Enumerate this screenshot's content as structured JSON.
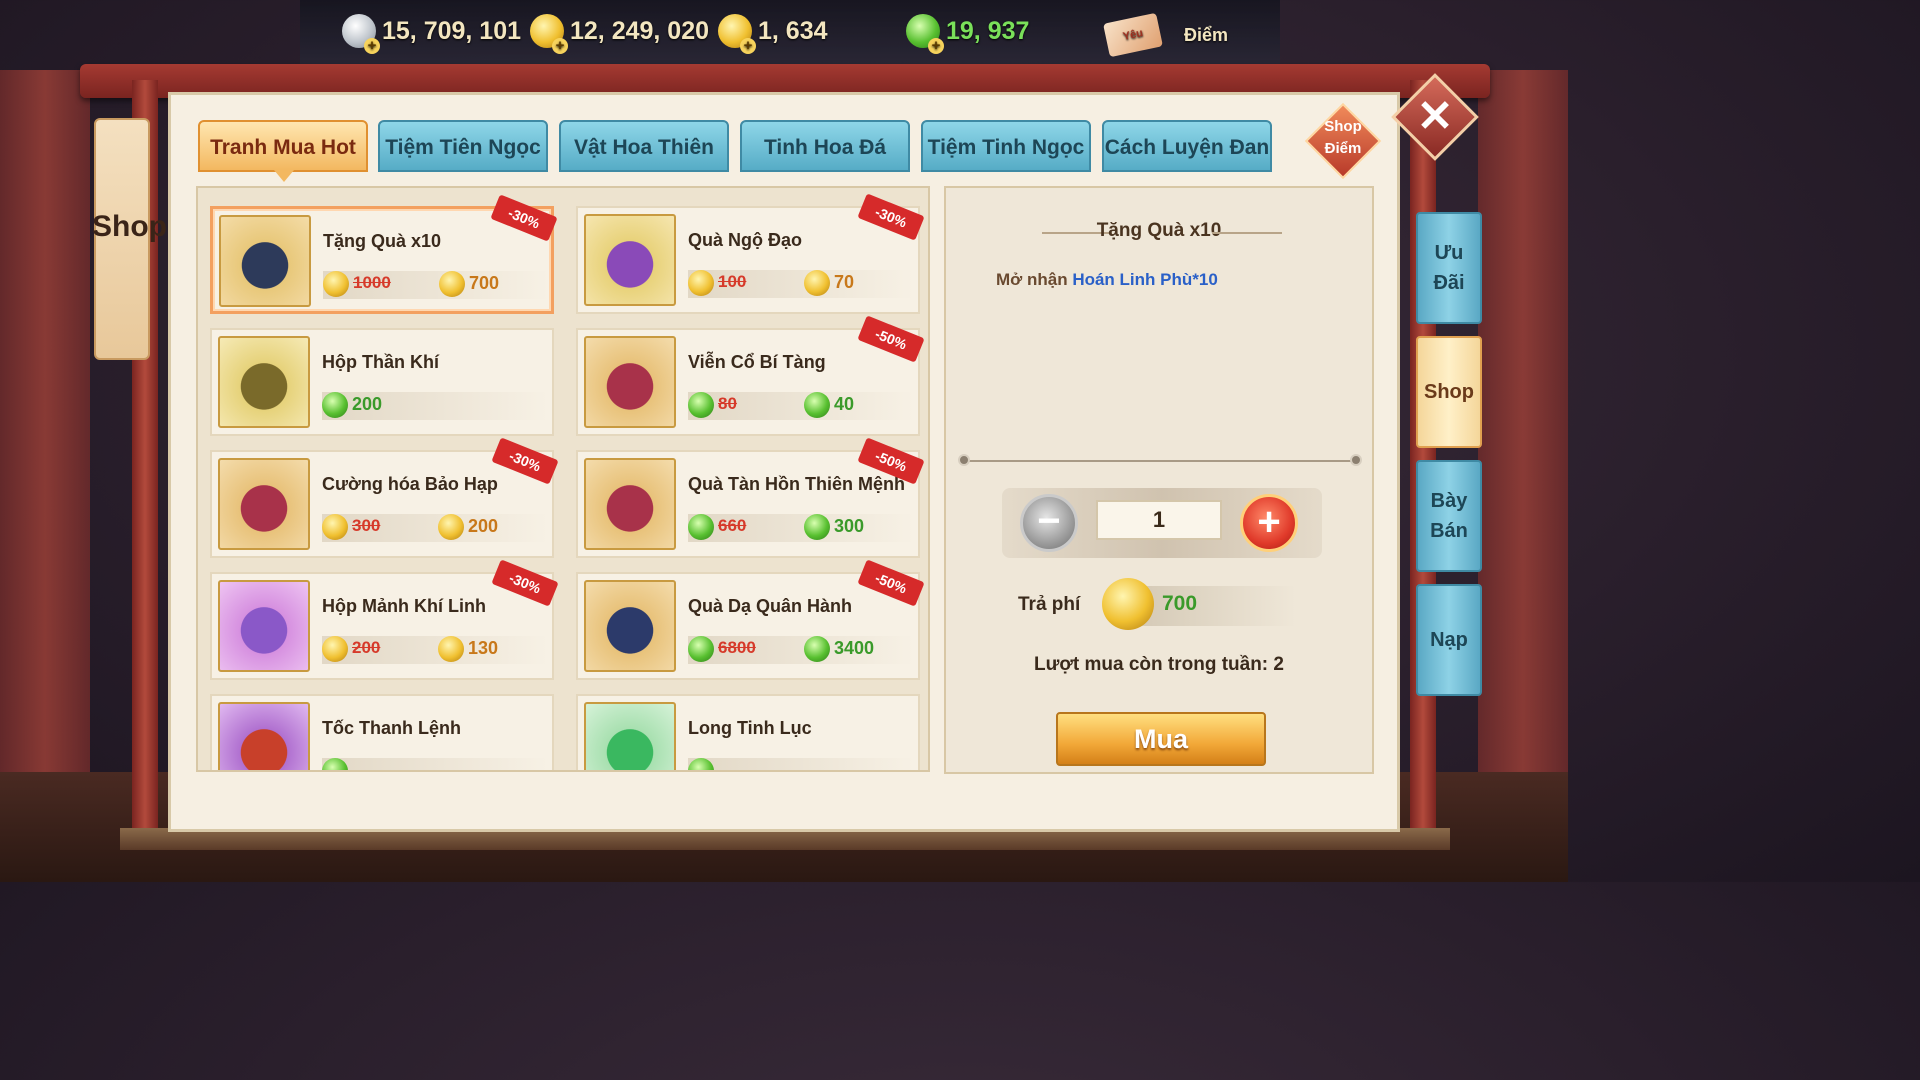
{
  "currencies": [
    {
      "icon": "silver-coin-icon",
      "value": "15, 709, 101"
    },
    {
      "icon": "gold-dragon-coin-icon",
      "value": "12, 249, 020"
    },
    {
      "icon": "gold-ingot-icon",
      "value": "1, 634"
    },
    {
      "icon": "jade-coin-icon",
      "value": "19, 937"
    }
  ],
  "points": {
    "ticket_text": "Yêu",
    "label": "Điểm"
  },
  "side_banner": {
    "label": "Shop"
  },
  "tabs": [
    {
      "label": "Tranh Mua Hot",
      "active": true
    },
    {
      "label": "Tiệm Tiên Ngọc",
      "active": false
    },
    {
      "label": "Vật Hoa Thiên Bảo",
      "active": false
    },
    {
      "label": "Tinh Hoa Đá Hồn",
      "active": false
    },
    {
      "label": "Tiệm Tinh Ngọc",
      "active": false
    },
    {
      "label": "Cách Luyện Đan",
      "active": false
    }
  ],
  "shop_points_button": {
    "line1": "Shop",
    "line2": "Điểm"
  },
  "items": [
    {
      "name": "Tặng Quà x10",
      "currency": "gold",
      "old_price": "1000",
      "price": "700",
      "discount": "-30%",
      "selected": true,
      "thumb": "chest-dark"
    },
    {
      "name": "Quà Ngộ Đạo",
      "currency": "gold",
      "old_price": "100",
      "price": "70",
      "discount": "-30%",
      "selected": false,
      "thumb": "chest-purple"
    },
    {
      "name": "Hộp Thần Khí",
      "currency": "jade",
      "old_price": "",
      "price": "200",
      "discount": "",
      "selected": false,
      "thumb": "chest-gold"
    },
    {
      "name": "Viễn Cổ Bí Tàng",
      "currency": "jade",
      "old_price": "80",
      "price": "40",
      "discount": "-50%",
      "selected": false,
      "thumb": "chest-red"
    },
    {
      "name": "Cường hóa Bảo Hạp",
      "currency": "gold",
      "old_price": "300",
      "price": "200",
      "discount": "-30%",
      "selected": false,
      "thumb": "chest-red"
    },
    {
      "name": "Quà Tàn Hồn Thiên Mệnh",
      "currency": "jade",
      "old_price": "660",
      "price": "300",
      "discount": "-50%",
      "selected": false,
      "thumb": "chest-red"
    },
    {
      "name": "Hộp Mảnh Khí Linh",
      "currency": "gold",
      "old_price": "200",
      "price": "130",
      "discount": "-30%",
      "selected": false,
      "thumb": "chest-violet"
    },
    {
      "name": "Quà Dạ Quân Hành",
      "currency": "jade",
      "old_price": "6800",
      "price": "3400",
      "discount": "-50%",
      "selected": false,
      "thumb": "gift-dark"
    },
    {
      "name": "Tốc Thanh Lệnh",
      "currency": "jade",
      "old_price": "",
      "price": "",
      "discount": "",
      "selected": false,
      "thumb": "token"
    },
    {
      "name": "Long Tinh Lục",
      "currency": "jade",
      "old_price": "",
      "price": "",
      "discount": "",
      "selected": false,
      "thumb": "jade-stone"
    }
  ],
  "detail": {
    "title": "Tặng Quà x10",
    "desc_prefix": "Mở nhận",
    "desc_highlight": "Hoán Linh Phù*10",
    "quantity": "1",
    "fee_label": "Trả phí",
    "fee_value": "700",
    "remaining": "Lượt mua còn trong tuần: 2",
    "buy_label": "Mua"
  },
  "side_tabs": [
    {
      "label": "Ưu Đãi",
      "active": false
    },
    {
      "label": "Shop",
      "active": true
    },
    {
      "label": "Bày Bán",
      "active": false
    },
    {
      "label": "Nạp",
      "active": false
    }
  ]
}
